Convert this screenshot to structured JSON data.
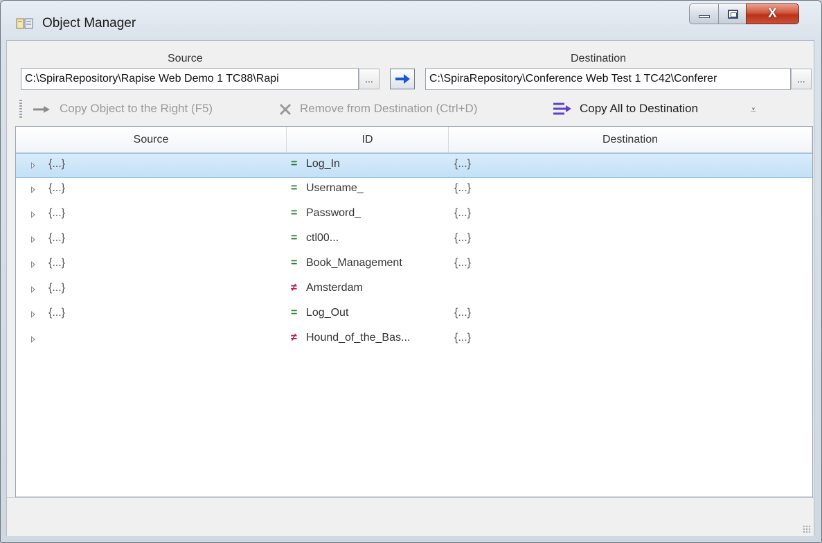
{
  "window": {
    "title": "Object Manager",
    "close_glyph": "X"
  },
  "source": {
    "label": "Source",
    "path": "C:\\SpiraRepository\\Rapise Web Demo 1 TC88\\Rapi",
    "browse": "..."
  },
  "destination": {
    "label": "Destination",
    "path": "C:\\SpiraRepository\\Conference Web Test 1 TC42\\Conferer",
    "browse": "..."
  },
  "toolbar": {
    "copy_right": "Copy Object to the Right (F5)",
    "remove": "Remove from Destination (Ctrl+D)",
    "copy_all": "Copy All to Destination",
    "overflow_glyph": "⩡"
  },
  "grid": {
    "columns": [
      "Source",
      "ID",
      "Destination"
    ],
    "rows": [
      {
        "source": "{...}",
        "match": "=",
        "id": "Log_In",
        "destination": "{...}"
      },
      {
        "source": "{...}",
        "match": "=",
        "id": "Username_",
        "destination": "{...}"
      },
      {
        "source": "{...}",
        "match": "=",
        "id": "Password_",
        "destination": "{...}"
      },
      {
        "source": "{...}",
        "match": "=",
        "id": "ctl00...",
        "destination": "{...}"
      },
      {
        "source": "{...}",
        "match": "=",
        "id": "Book_Management",
        "destination": "{...}"
      },
      {
        "source": "{...}",
        "match": "≠",
        "id": "Amsterdam",
        "destination": ""
      },
      {
        "source": "{...}",
        "match": "=",
        "id": "Log_Out",
        "destination": "{...}"
      },
      {
        "source": "",
        "match": "≠",
        "id": "Hound_of_the_Bas...",
        "destination": "{...}"
      }
    ]
  },
  "colors": {
    "match_equal": "#2e7d32",
    "match_differ": "#c2185b",
    "selection": "#c3e0f6",
    "sync_arrow": "#1a56d6"
  },
  "icons": {
    "app": "object-manager-icon",
    "sync": "right-arrow-icon",
    "copy_right": "gray-arrow-icon",
    "remove": "x-icon",
    "copy_all": "copy-all-icon"
  }
}
